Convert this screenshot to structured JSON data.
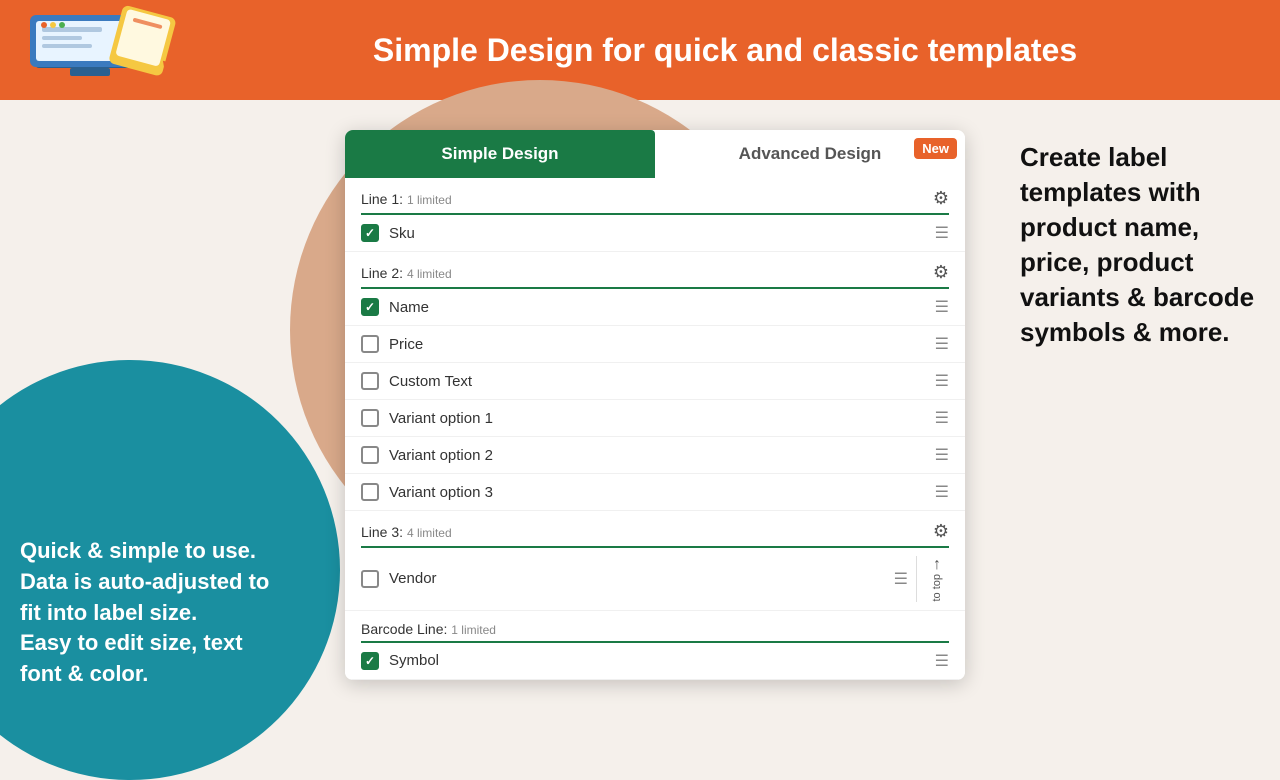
{
  "header": {
    "title": "Simple Design for quick and classic templates",
    "logo_alt": "App Logo"
  },
  "tabs": {
    "simple": "Simple Design",
    "advanced": "Advanced Design",
    "new_badge": "New"
  },
  "sections": [
    {
      "id": "line1",
      "label": "Line 1",
      "limit_text": "1 limited",
      "items": [
        {
          "id": "sku",
          "label": "Sku",
          "checked": true
        }
      ]
    },
    {
      "id": "line2",
      "label": "Line 2",
      "limit_text": "4 limited",
      "items": [
        {
          "id": "name",
          "label": "Name",
          "checked": true
        },
        {
          "id": "price",
          "label": "Price",
          "checked": false
        },
        {
          "id": "custom_text",
          "label": "Custom Text",
          "checked": false
        },
        {
          "id": "variant1",
          "label": "Variant option 1",
          "checked": false
        },
        {
          "id": "variant2",
          "label": "Variant option 2",
          "checked": false
        },
        {
          "id": "variant3",
          "label": "Variant option 3",
          "checked": false
        }
      ]
    },
    {
      "id": "line3",
      "label": "Line 3",
      "limit_text": "4 limited",
      "items": [
        {
          "id": "vendor",
          "label": "Vendor",
          "checked": false
        }
      ]
    },
    {
      "id": "barcode",
      "label": "Barcode Line",
      "limit_text": "1 limited",
      "items": [
        {
          "id": "symbol",
          "label": "Symbol",
          "checked": true
        }
      ]
    }
  ],
  "left_text": "Quick & simple to use.\nData is auto-adjusted to fit into label size.\nEasy to edit size, text font & color.",
  "right_text": "Create label templates with product name, price, product variants & barcode symbols & more.",
  "scroll_hint": "to top"
}
